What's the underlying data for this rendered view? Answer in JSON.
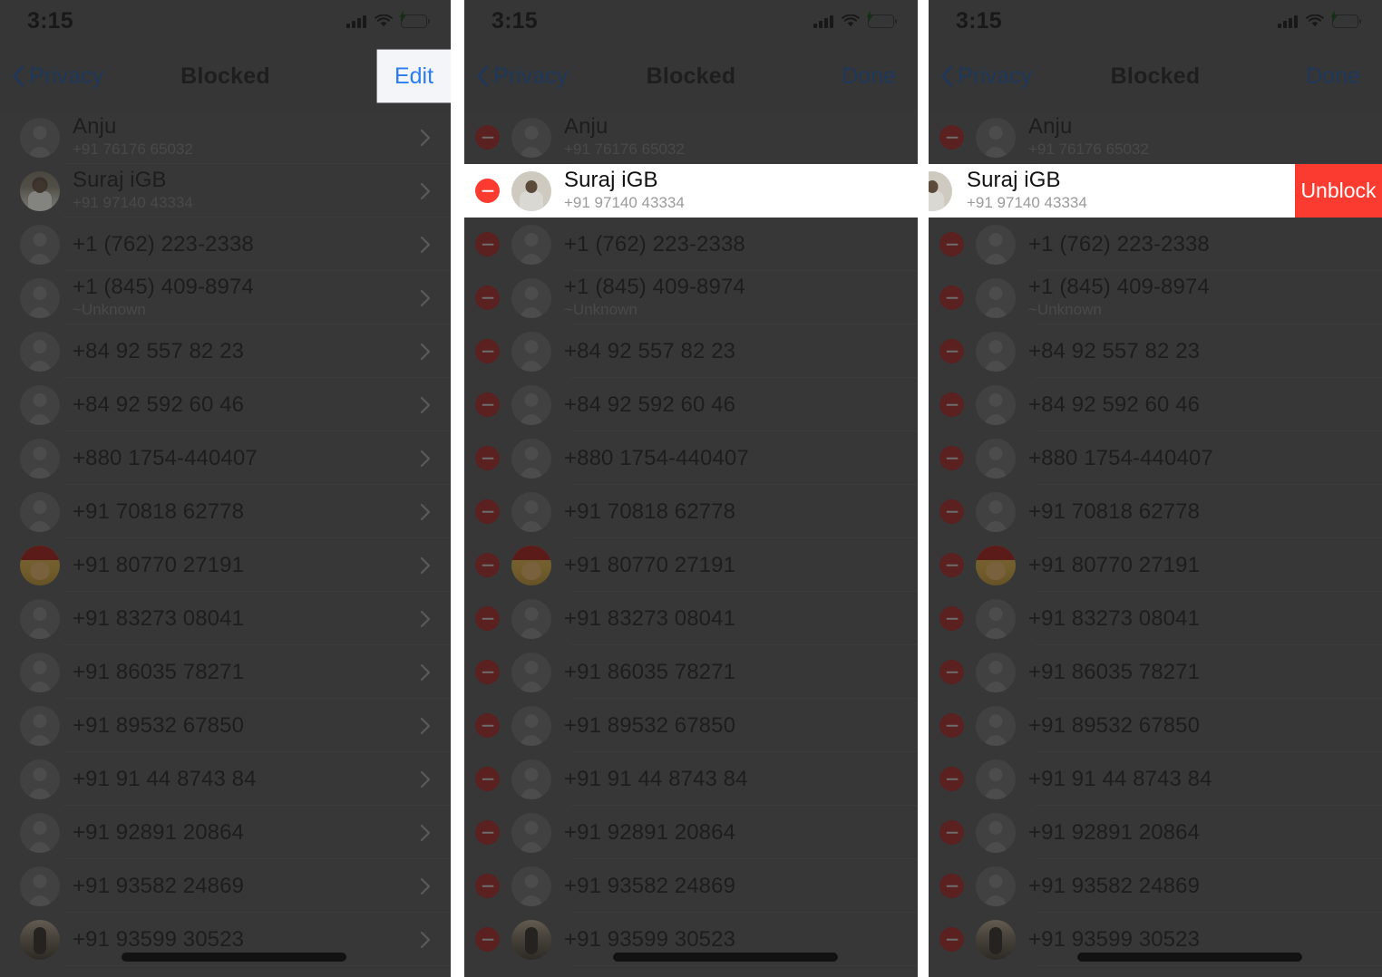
{
  "status_bar": {
    "time": "3:15",
    "icons": [
      "signal-bars-icon",
      "wifi-icon",
      "battery-charging-icon"
    ]
  },
  "colors": {
    "accent_blue": "#2a7df0",
    "nav_blue": "#1d4f8f",
    "destructive_red": "#fb3b30",
    "minus_red_dim": "#8f2222",
    "panel_bg": "#4d4d4d",
    "highlight_white": "#ffffff",
    "edit_highlight_box": "#f4f5f9"
  },
  "panels": [
    {
      "id": "panel-view",
      "nav": {
        "back_label": "Privacy",
        "title": "Blocked",
        "action_label": "Edit",
        "action_highlighted": true
      },
      "edit_mode": false
    },
    {
      "id": "panel-edit",
      "nav": {
        "back_label": "Privacy",
        "title": "Blocked",
        "action_label": "Done",
        "action_highlighted": false
      },
      "edit_mode": true,
      "highlighted_row_index": 1
    },
    {
      "id": "panel-unblock",
      "nav": {
        "back_label": "Privacy",
        "title": "Blocked",
        "action_label": "Done",
        "action_highlighted": false
      },
      "edit_mode": true,
      "highlighted_row_index": 1,
      "swipe_action_label": "Unblock"
    }
  ],
  "blocked_list": [
    {
      "name": "Anju",
      "sub": "+91 76176 65032",
      "avatar": "placeholder"
    },
    {
      "name": "Suraj iGB",
      "sub": "+91 97140 43334",
      "avatar": "photo-suraj"
    },
    {
      "name": "+1 (762) 223-2338",
      "sub": "",
      "avatar": "placeholder"
    },
    {
      "name": "+1 (845) 409-8974",
      "sub": "~Unknown",
      "avatar": "placeholder"
    },
    {
      "name": "+84 92 557 82 23",
      "sub": "",
      "avatar": "placeholder"
    },
    {
      "name": "+84 92 592 60 46",
      "sub": "",
      "avatar": "placeholder"
    },
    {
      "name": "+880 1754-440407",
      "sub": "",
      "avatar": "placeholder"
    },
    {
      "name": "+91 70818 62778",
      "sub": "",
      "avatar": "placeholder"
    },
    {
      "name": "+91 80770 27191",
      "sub": "",
      "avatar": "photo-cap"
    },
    {
      "name": "+91 83273 08041",
      "sub": "",
      "avatar": "placeholder"
    },
    {
      "name": "+91 86035 78271",
      "sub": "",
      "avatar": "placeholder"
    },
    {
      "name": "+91 89532 67850",
      "sub": "",
      "avatar": "placeholder"
    },
    {
      "name": "+91 91 44 8743 84",
      "sub": "",
      "avatar": "placeholder"
    },
    {
      "name": "+91 92891 20864",
      "sub": "",
      "avatar": "placeholder"
    },
    {
      "name": "+91 93582 24869",
      "sub": "",
      "avatar": "placeholder"
    },
    {
      "name": "+91 93599 30523",
      "sub": "",
      "avatar": "photo-dark",
      "redacted": true
    }
  ]
}
